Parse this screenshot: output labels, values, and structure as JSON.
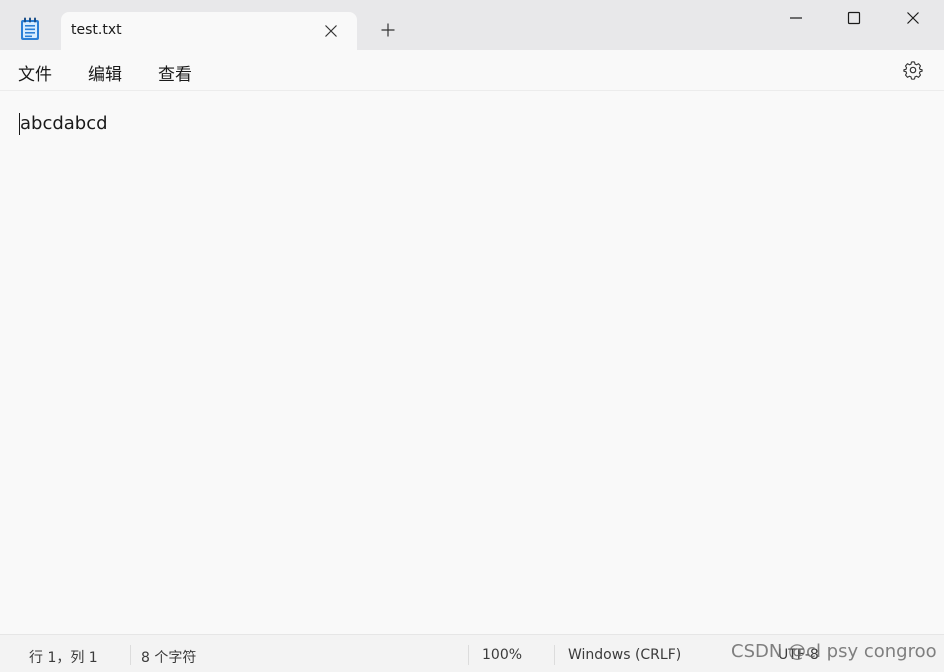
{
  "tab": {
    "title": "test.txt"
  },
  "menu": {
    "file": "文件",
    "edit": "编辑",
    "view": "查看"
  },
  "editor": {
    "content": "abcdabcd"
  },
  "status": {
    "position": "行 1，列 1",
    "char_count": "8 个字符",
    "zoom": "100%",
    "line_ending": "Windows (CRLF)",
    "encoding": "UTF-8"
  },
  "watermark": "CSDN @cl psy congroo",
  "icons": {
    "app": "notepad-icon",
    "tab_close": "close-icon",
    "new_tab": "plus-icon",
    "minimize": "minimize-icon",
    "maximize": "maximize-icon",
    "close": "close-icon",
    "settings": "gear-icon"
  },
  "colors": {
    "titlebar_bg": "#e8e8ea",
    "content_bg": "#f9f9f9",
    "statusbar_bg": "#f3f3f3",
    "app_icon_accent": "#2b7fd6"
  }
}
